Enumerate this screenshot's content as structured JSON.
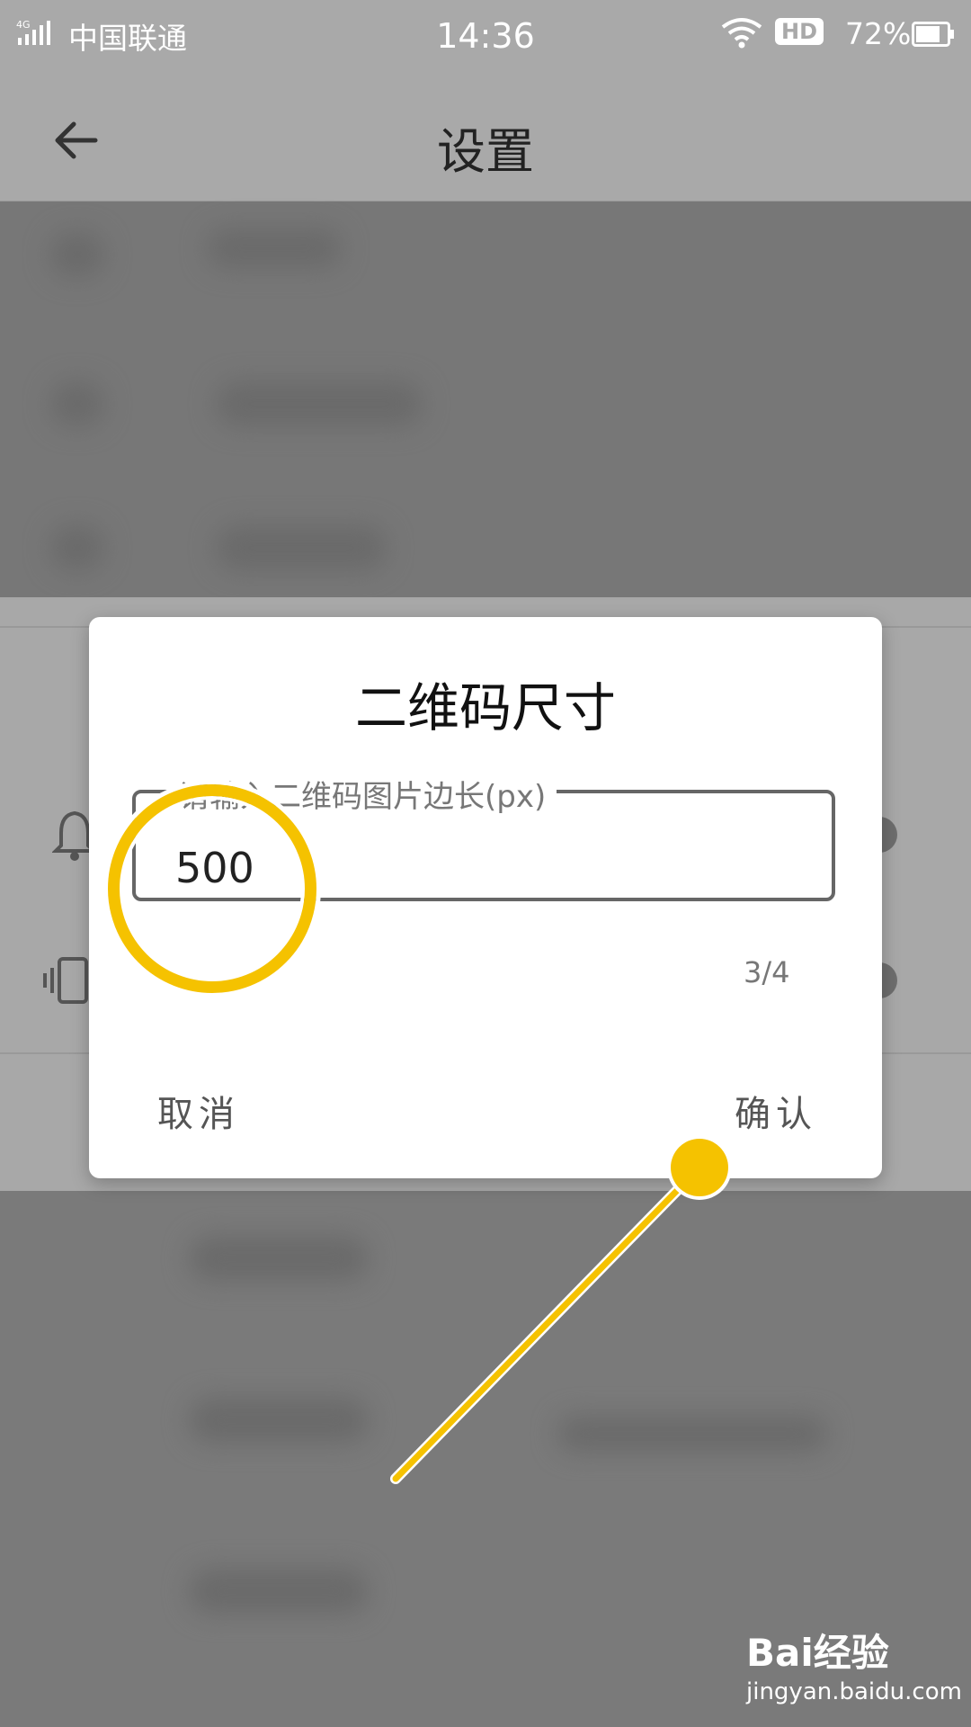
{
  "status_bar": {
    "network": "4G",
    "carrier": "中国联通",
    "time": "14:36",
    "hd": "HD",
    "battery": "72%"
  },
  "app_bar": {
    "title": "设置",
    "back_icon": "arrow-left-icon"
  },
  "dialog": {
    "title": "二维码尺寸",
    "input_label": "请输入二维码图片边长(px)",
    "input_value": "500",
    "counter": "3/4",
    "cancel": "取消",
    "confirm": "确认"
  },
  "background_icons": [
    "bell-icon",
    "vibrate-icon"
  ],
  "watermark": {
    "brand": "Bai经验",
    "url": "jingyan.baidu.com"
  },
  "colors": {
    "accent": "#f5c200",
    "dialog_bg": "#ffffff",
    "scrim": "#808080"
  }
}
